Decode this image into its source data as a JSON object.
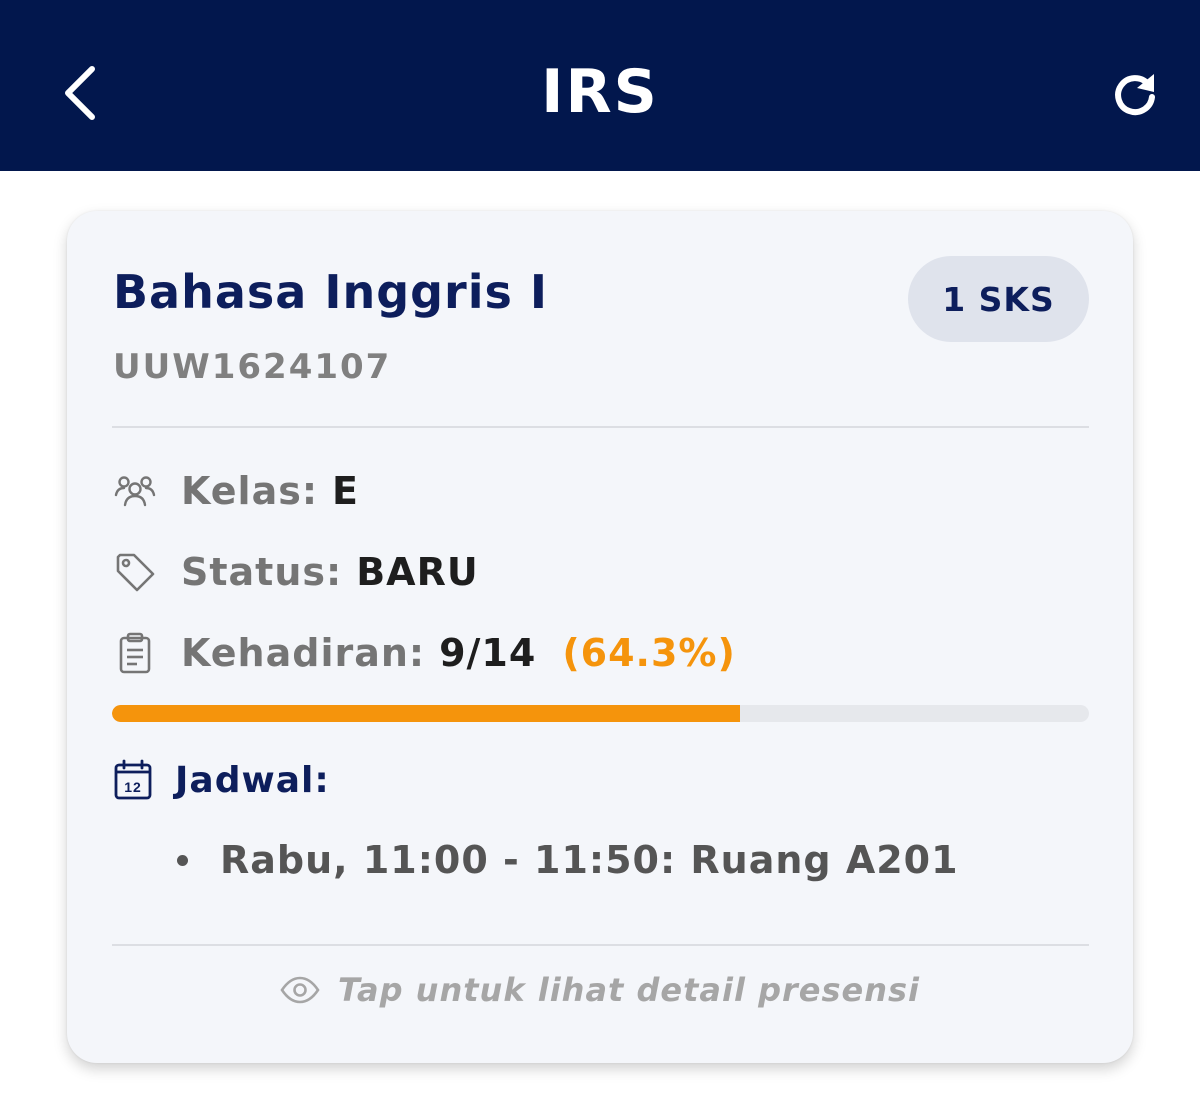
{
  "app_bar": {
    "title": "IRS",
    "back_icon": "chevron-left-icon",
    "refresh_icon": "refresh-icon"
  },
  "course": {
    "name": "Bahasa Inggris I",
    "credits": "1 SKS",
    "code": "UUW1624107",
    "class": {
      "label": "Kelas:",
      "value": "E",
      "icon": "users-icon"
    },
    "status": {
      "label": "Status:",
      "value": "BARU",
      "icon": "tag-icon"
    },
    "attendance": {
      "label": "Kehadiran:",
      "value": "9/14",
      "percent_text": "(64.3%)",
      "progress": 0.643,
      "icon": "clipboard-icon"
    },
    "schedule": {
      "label": "Jadwal:",
      "icon": "calendar-icon",
      "calendar_day": "12",
      "items": [
        "Rabu, 11:00 - 11:50: Ruang A201"
      ]
    },
    "hint": {
      "text": "Tap untuk lihat detail presensi",
      "icon": "eye-icon"
    }
  },
  "colors": {
    "app_bar_bg": "#02174d",
    "accent_orange": "#f5940c",
    "title_navy": "#0d1e5c",
    "card_bg": "#f4f6fa"
  }
}
